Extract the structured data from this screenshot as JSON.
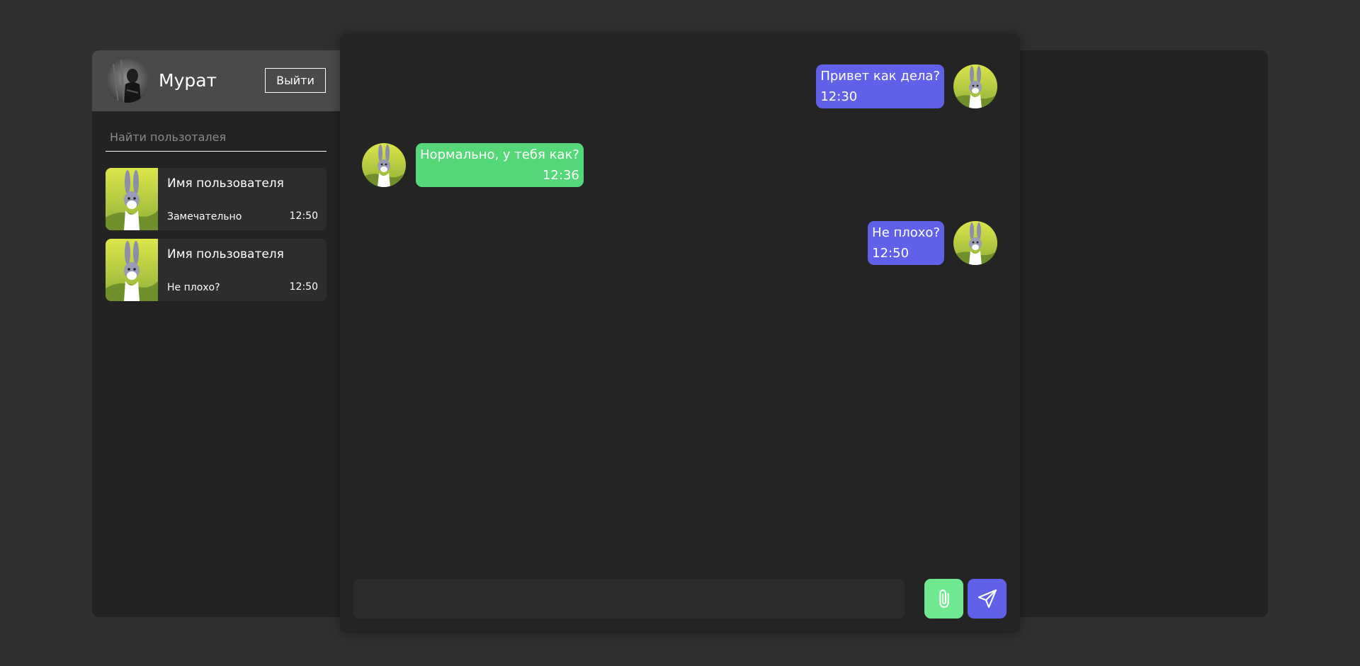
{
  "colors": {
    "page_bg": "#303030",
    "panel_bg": "#232323",
    "header_bg": "#4a4a4a",
    "outgoing_bubble": "#6160e8",
    "incoming_bubble": "#55d878",
    "attach_button": "#6ee98f",
    "send_button": "#6160e8"
  },
  "profile": {
    "name": "Мурат",
    "logout_label": "Выйти",
    "avatar_icon": "profile-photo"
  },
  "search": {
    "placeholder": "Найти пользоталея",
    "value": ""
  },
  "contacts": [
    {
      "name": "Имя пользователя",
      "preview": "Замечательно",
      "time": "12:50",
      "avatar_icon": "bunny-cartoon"
    },
    {
      "name": "Имя пользователя",
      "preview": "Не плохо?",
      "time": "12:50",
      "avatar_icon": "bunny-cartoon"
    }
  ],
  "messages": [
    {
      "direction": "outgoing",
      "text": "Привет как дела?",
      "time": "12:30"
    },
    {
      "direction": "incoming",
      "text": "Нормально, у тебя как?",
      "time": "12:36"
    },
    {
      "direction": "outgoing",
      "text": "Не плохо?",
      "time": "12:50"
    }
  ],
  "composer": {
    "value": "",
    "placeholder": "",
    "attach_icon": "paperclip-icon",
    "send_icon": "send-icon"
  }
}
